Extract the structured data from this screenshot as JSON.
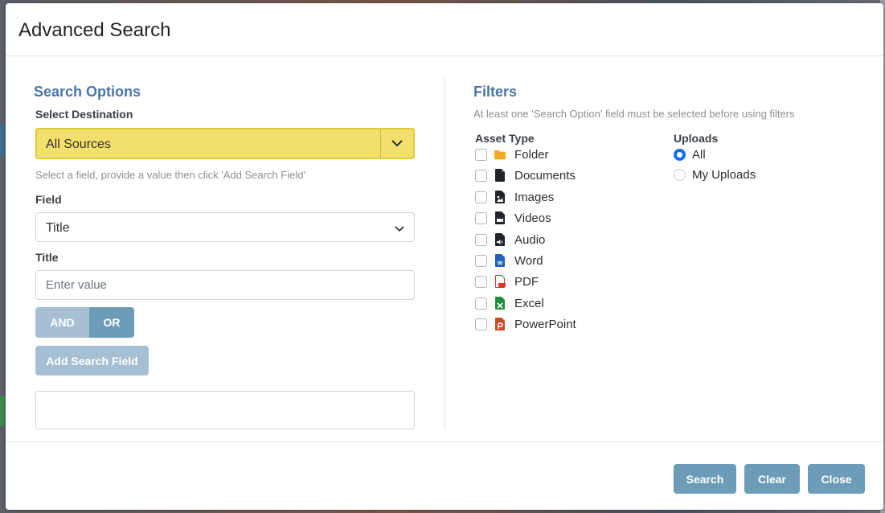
{
  "dialog": {
    "title": "Advanced Search"
  },
  "search_options": {
    "heading": "Search Options",
    "destination_label": "Select Destination",
    "destination_value": "All Sources",
    "hint": "Select a field, provide a value then click 'Add Search Field'",
    "field_label": "Field",
    "field_value": "Title",
    "value_label": "Title",
    "value_placeholder": "Enter value",
    "and_label": "AND",
    "or_label": "OR",
    "add_button": "Add Search Field"
  },
  "filters": {
    "heading": "Filters",
    "hint": "At least one 'Search Option' field must be selected before using filters",
    "asset_type_label": "Asset Type",
    "asset_types": [
      {
        "label": "Folder",
        "icon": "folder-icon",
        "color": "#f5a623"
      },
      {
        "label": "Documents",
        "icon": "document-icon",
        "color": "#212529"
      },
      {
        "label": "Images",
        "icon": "image-file-icon",
        "color": "#212529"
      },
      {
        "label": "Videos",
        "icon": "video-file-icon",
        "color": "#212529"
      },
      {
        "label": "Audio",
        "icon": "audio-file-icon",
        "color": "#212529"
      },
      {
        "label": "Word",
        "icon": "word-file-icon",
        "color": "#1f5fbf"
      },
      {
        "label": "PDF",
        "icon": "pdf-file-icon",
        "color": "#e0362a"
      },
      {
        "label": "Excel",
        "icon": "excel-file-icon",
        "color": "#1e8e3e"
      },
      {
        "label": "PowerPoint",
        "icon": "powerpoint-file-icon",
        "color": "#d24726"
      }
    ],
    "uploads_label": "Uploads",
    "uploads": [
      {
        "label": "All",
        "checked": true
      },
      {
        "label": "My Uploads",
        "checked": false
      }
    ]
  },
  "footer": {
    "search_label": "Search",
    "clear_label": "Clear",
    "close_label": "Close"
  },
  "colors": {
    "accent": "#4a76a8",
    "button": "#6d9cb8",
    "button_disabled": "#a6bfd2",
    "highlight": "#f3df6b",
    "radio_checked": "#0d6efd"
  }
}
